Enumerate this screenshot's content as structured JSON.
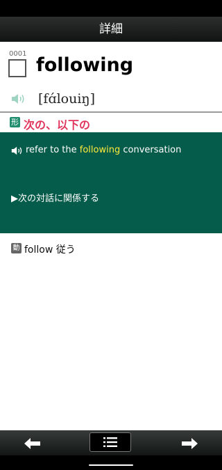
{
  "header": {
    "title": "詳細"
  },
  "entry": {
    "number": "0001",
    "headword": "following",
    "phonetic": "[fɑ́louiŋ]",
    "pos_badge": "形",
    "meaning": "次の、以下の",
    "example": {
      "before": "refer to the ",
      "highlight": "following",
      "after": " conversation",
      "translation": "▶次の対話に関係する"
    },
    "related": {
      "badge": "動",
      "text": "follow 従う"
    }
  },
  "icons": {
    "checkbox": "checkbox-empty",
    "pronunciation": "speaker-icon",
    "prev": "arrow-left-icon",
    "menu": "list-icon",
    "next": "arrow-right-icon"
  },
  "colors": {
    "title_bar": "#1b1f1d",
    "meaning": "#e0365d",
    "pos_badge": "#1f8d6e",
    "example_panel": "#055c4a",
    "highlight": "#ffeb3b"
  }
}
